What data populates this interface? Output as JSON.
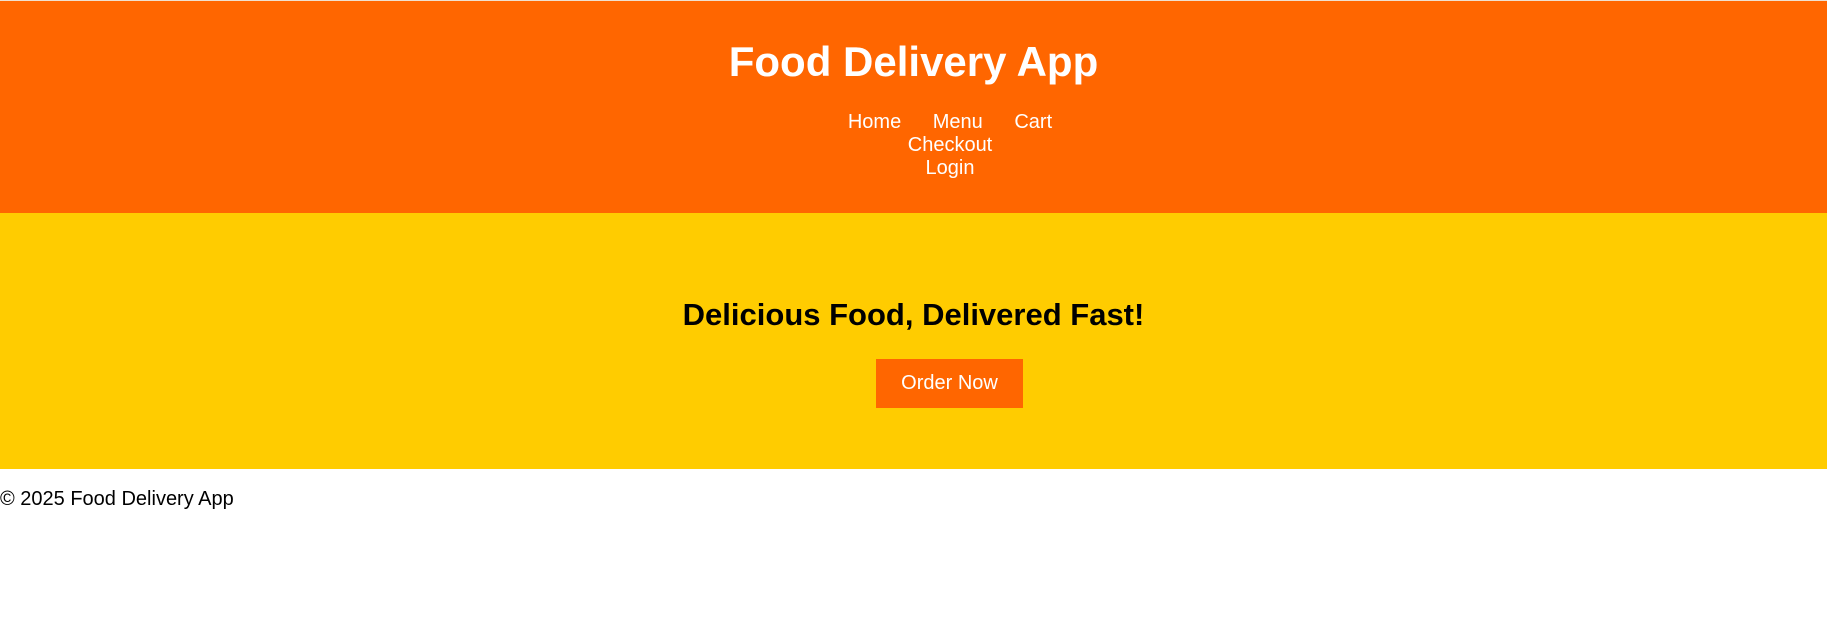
{
  "header": {
    "title": "Food Delivery App",
    "nav": [
      {
        "label": "Home"
      },
      {
        "label": "Menu"
      },
      {
        "label": "Cart"
      },
      {
        "label": "Checkout"
      },
      {
        "label": "Login"
      }
    ]
  },
  "hero": {
    "heading": "Delicious Food, Delivered Fast!",
    "cta_label": "Order Now"
  },
  "footer": {
    "copyright": "© 2025 Food Delivery App"
  },
  "colors": {
    "header_bg": "#ff6600",
    "hero_bg": "#ffcc00",
    "button_bg": "#ff6600",
    "text_light": "#ffffff",
    "text_dark": "#000000"
  }
}
